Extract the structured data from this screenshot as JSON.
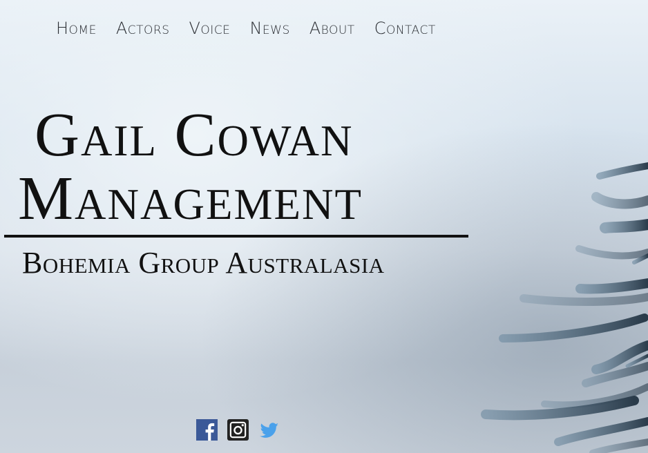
{
  "nav": {
    "items": [
      {
        "label": "Home"
      },
      {
        "label": "Actors"
      },
      {
        "label": "Voice"
      },
      {
        "label": "News"
      },
      {
        "label": "About"
      },
      {
        "label": "Contact"
      }
    ]
  },
  "logo": {
    "line1": "Gail Cowan",
    "line2": "Management",
    "line3": "Bohemia Group Australasia"
  },
  "social": {
    "icons": [
      "facebook-icon",
      "instagram-icon",
      "twitter-icon"
    ],
    "colors": {
      "facebook": "#3b5998",
      "instagram": "#222222",
      "twitter": "#4aa1eb"
    }
  }
}
